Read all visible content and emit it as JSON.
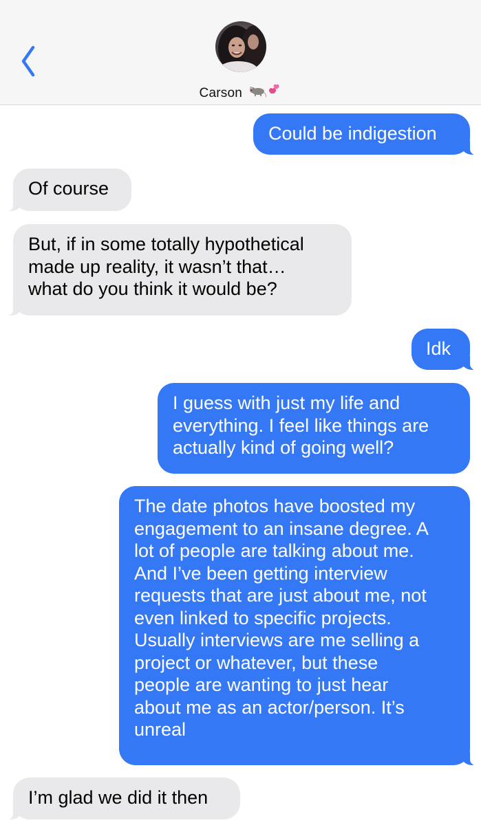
{
  "header": {
    "contact_name": "Carson",
    "contact_emoji": "🐀💕",
    "back_icon": "chevron-left-icon"
  },
  "messages": [
    {
      "direction": "sent",
      "text": "Could be indigestion"
    },
    {
      "direction": "received",
      "text": "Of course"
    },
    {
      "direction": "received",
      "text": "But, if in some totally hypothetical\nmade up reality, it wasn’t that…\nwhat do you think it would be?"
    },
    {
      "direction": "sent",
      "text": "Idk"
    },
    {
      "direction": "sent",
      "text": "I guess with just my life and\neverything. I feel like things are\nactually kind of going well?"
    },
    {
      "direction": "sent",
      "text": "The date photos have boosted my\nengagement to an insane degree. A\nlot of people are talking about me.\nAnd I’ve been getting interview\nrequests that are just about me, not\neven linked to specific projects.\nUsually interviews are me selling a\nproject or whatever, but these\npeople are wanting to just hear\nabout me as an actor/person. It’s\nunreal"
    },
    {
      "direction": "received",
      "text": "I’m glad we did it then"
    }
  ],
  "colors": {
    "sent_bubble": "#3478f6",
    "received_bubble": "#e9e9eb",
    "header_bg": "#f6f6f7",
    "accent": "#3478f6"
  }
}
